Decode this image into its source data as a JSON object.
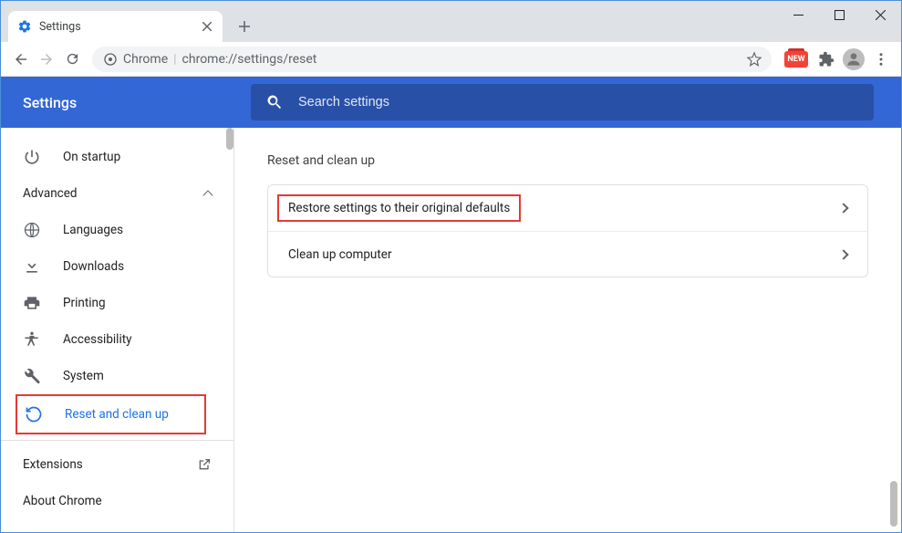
{
  "window": {
    "tab_title": "Settings",
    "new_badge": "NEW"
  },
  "addr": {
    "secure_label": "Chrome",
    "url": "chrome://settings/reset"
  },
  "header": {
    "title": "Settings",
    "search_placeholder": "Search settings"
  },
  "sidebar": {
    "startup": "On startup",
    "advanced": "Advanced",
    "languages": "Languages",
    "downloads": "Downloads",
    "printing": "Printing",
    "accessibility": "Accessibility",
    "system": "System",
    "reset": "Reset and clean up",
    "extensions": "Extensions",
    "about": "About Chrome"
  },
  "main": {
    "section": "Reset and clean up",
    "row1": "Restore settings to their original defaults",
    "row2": "Clean up computer"
  }
}
